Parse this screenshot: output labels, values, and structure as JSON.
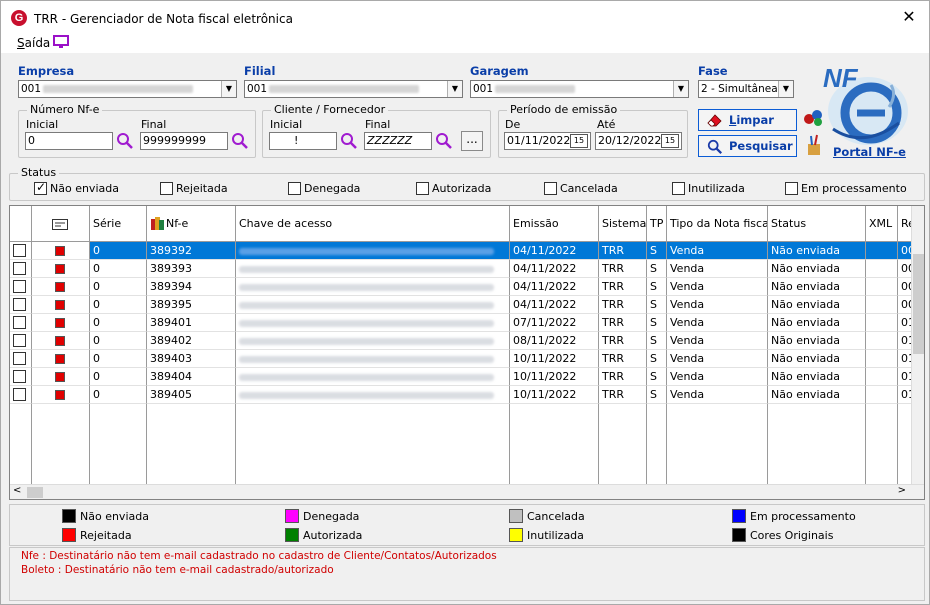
{
  "window": {
    "title": "TRR - Gerenciador de Nota fiscal eletrônica",
    "close_glyph": "✕"
  },
  "menu": {
    "saida_first": "S",
    "saida_rest": "aída"
  },
  "filters": {
    "empresa": {
      "label": "Empresa",
      "value": "001"
    },
    "filial": {
      "label": "Filial",
      "value": "001"
    },
    "garagem": {
      "label": "Garagem",
      "value": "001"
    },
    "fase": {
      "label": "Fase",
      "value": "2 - Simultânea"
    },
    "numero_nfe": {
      "title": "Número Nf-e",
      "inicial_label": "Inicial",
      "inicial_value": "0",
      "final_label": "Final",
      "final_value": "999999999"
    },
    "cliente": {
      "title": "Cliente / Fornecedor",
      "inicial_label": "Inicial",
      "inicial_value": "!",
      "final_label": "Final",
      "final_value": "ZZZZZZ",
      "dots": "..."
    },
    "periodo": {
      "title": "Período de emissão",
      "de_label": "De",
      "de_value": "01/11/2022",
      "ate_label": "Até",
      "ate_value": "20/12/2022",
      "cal_glyph": "15"
    }
  },
  "buttons": {
    "limpar_first": "L",
    "limpar_rest": "impar",
    "pesquisar": "Pesquisar"
  },
  "logo": {
    "text": "NF",
    "small": "e"
  },
  "portal_link": "Portal NF-e",
  "status": {
    "title": "Status",
    "items": [
      {
        "label": "Não enviada",
        "checked": true
      },
      {
        "label": "Rejeitada",
        "checked": false
      },
      {
        "label": "Denegada",
        "checked": false
      },
      {
        "label": "Autorizada",
        "checked": false
      },
      {
        "label": "Cancelada",
        "checked": false
      },
      {
        "label": "Inutilizada",
        "checked": false
      },
      {
        "label": "Em processamento",
        "checked": false
      }
    ]
  },
  "grid": {
    "columns": [
      "",
      "",
      "Série",
      "Nf-e",
      "Chave de acesso",
      "Emissão",
      "Sistema",
      "TP",
      "Tipo da Nota fiscal",
      "Status",
      "XML",
      "Re"
    ],
    "rows": [
      {
        "serie": "0",
        "nfe": "389392",
        "emissao": "04/11/2022",
        "sistema": "TRR",
        "tp": "S",
        "tipo": "Venda",
        "status": "Não enviada",
        "re": "00"
      },
      {
        "serie": "0",
        "nfe": "389393",
        "emissao": "04/11/2022",
        "sistema": "TRR",
        "tp": "S",
        "tipo": "Venda",
        "status": "Não enviada",
        "re": "00"
      },
      {
        "serie": "0",
        "nfe": "389394",
        "emissao": "04/11/2022",
        "sistema": "TRR",
        "tp": "S",
        "tipo": "Venda",
        "status": "Não enviada",
        "re": "00"
      },
      {
        "serie": "0",
        "nfe": "389395",
        "emissao": "04/11/2022",
        "sistema": "TRR",
        "tp": "S",
        "tipo": "Venda",
        "status": "Não enviada",
        "re": "00"
      },
      {
        "serie": "0",
        "nfe": "389401",
        "emissao": "07/11/2022",
        "sistema": "TRR",
        "tp": "S",
        "tipo": "Venda",
        "status": "Não enviada",
        "re": "01"
      },
      {
        "serie": "0",
        "nfe": "389402",
        "emissao": "08/11/2022",
        "sistema": "TRR",
        "tp": "S",
        "tipo": "Venda",
        "status": "Não enviada",
        "re": "01"
      },
      {
        "serie": "0",
        "nfe": "389403",
        "emissao": "10/11/2022",
        "sistema": "TRR",
        "tp": "S",
        "tipo": "Venda",
        "status": "Não enviada",
        "re": "01"
      },
      {
        "serie": "0",
        "nfe": "389404",
        "emissao": "10/11/2022",
        "sistema": "TRR",
        "tp": "S",
        "tipo": "Venda",
        "status": "Não enviada",
        "re": "01"
      },
      {
        "serie": "0",
        "nfe": "389405",
        "emissao": "10/11/2022",
        "sistema": "TRR",
        "tp": "S",
        "tipo": "Venda",
        "status": "Não enviada",
        "re": "01"
      }
    ]
  },
  "legend": [
    {
      "label": "Não enviada",
      "color": "#000000"
    },
    {
      "label": "Denegada",
      "color": "#ff00ff"
    },
    {
      "label": "Cancelada",
      "color": "#c0c0c0"
    },
    {
      "label": "Em processamento",
      "color": "#0000ff"
    },
    {
      "label": "Rejeitada",
      "color": "#ff0000"
    },
    {
      "label": "Autorizada",
      "color": "#008000"
    },
    {
      "label": "Inutilizada",
      "color": "#ffff00"
    },
    {
      "label": "Cores Originais",
      "color": "#000000"
    }
  ],
  "messages": [
    "Nfe    : Destinatário não tem e-mail cadastrado no cadastro de Cliente/Contatos/Autorizados",
    "Boleto : Destinatário não tem e-mail cadastrado/autorizado"
  ],
  "scroll": {
    "left_glyph": "<",
    "right_glyph": ">"
  }
}
